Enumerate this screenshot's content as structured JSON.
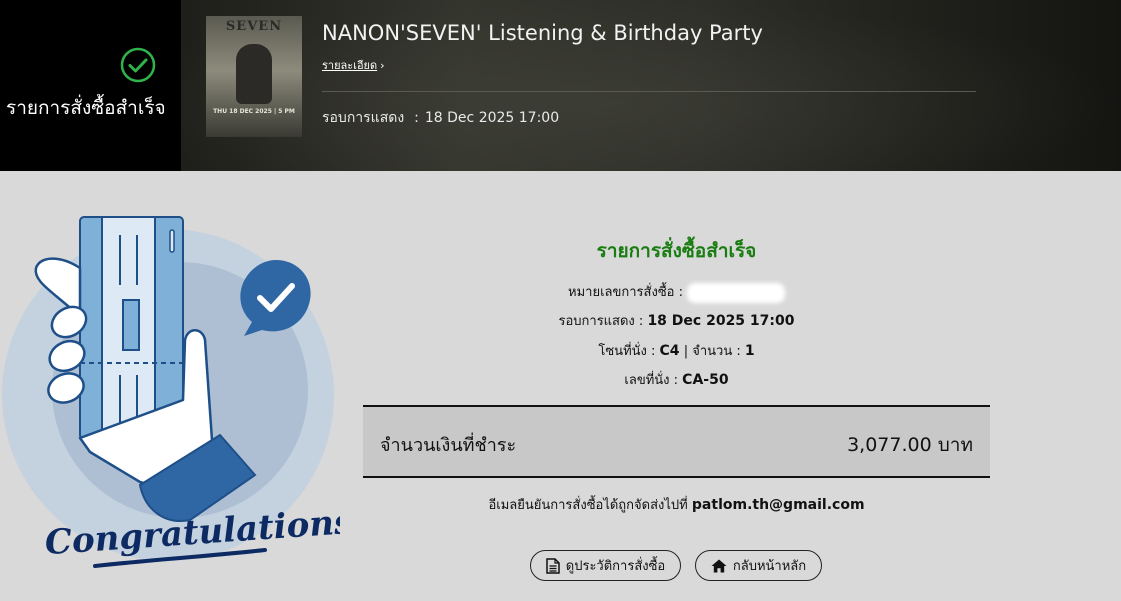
{
  "header": {
    "status_text": "รายการสั่งซื้อสำเร็จ",
    "event_title": "NANON'SEVEN' Listening & Birthday Party",
    "details_link": "รายละเอียด",
    "showtime_label": "รอบการแสดง",
    "showtime_sep": ":",
    "showtime_value": "18 Dec 2025 17:00",
    "poster": {
      "title": "SEVEN",
      "date": "THU 18 DEC 2025 | 5 PM"
    }
  },
  "illustration": {
    "caption": "Congratulations"
  },
  "summary": {
    "heading": "รายการสั่งซื้อสำเร็จ",
    "order_no_label": "หมายเลขการสั่งซื้อ :",
    "showtime_label": "รอบการแสดง :",
    "showtime_value": "18 Dec 2025 17:00",
    "zone_label": "โซนที่นั่ง :",
    "zone_value": "C4",
    "qty_sep": "|",
    "qty_label": "จำนวน :",
    "qty_value": "1",
    "seat_label": "เลขที่นั่ง :",
    "seat_value": "CA-50",
    "total_label": "จำนวนเงินที่ชำระ",
    "total_value": "3,077.00 บาท",
    "email_text": "อีเมลยืนยันการสั่งซื้อได้ถูกจัดส่งไปที่",
    "email_value": "patlom.th@gmail.com"
  },
  "buttons": {
    "history": "ดูประวัติการสั่งซื้อ",
    "home": "กลับหน้าหลัก"
  },
  "colors": {
    "success_green": "#1a7d12",
    "header_bg": "#000000",
    "page_bg": "#d9d9d9",
    "total_bg": "#c8c8c8",
    "illustration_blue": "#2f67a5",
    "card_blue": "#7fb0d8"
  }
}
